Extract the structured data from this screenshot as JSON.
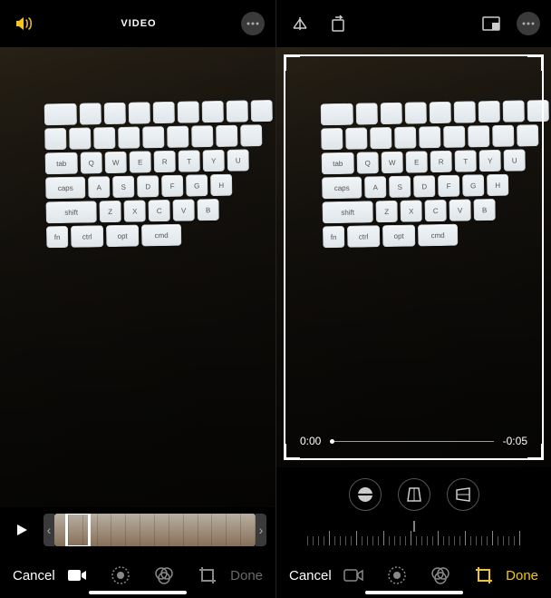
{
  "left": {
    "topbar": {
      "title": "VIDEO"
    },
    "toolbar": {
      "cancel": "Cancel",
      "done": "Done"
    }
  },
  "right": {
    "timecodes": {
      "current": "0:00",
      "remaining": "-0:05"
    },
    "toolbar": {
      "cancel": "Cancel",
      "done": "Done"
    }
  },
  "colors": {
    "accent": "#f5c518",
    "muted": "#6a6a6a"
  },
  "icons": {
    "sound": "sound-icon",
    "more": "more-icon",
    "perspective": "perspective-icon",
    "aspect": "aspect-ratio-icon",
    "play": "play-icon",
    "video": "video-icon",
    "adjust": "adjust-icon",
    "filters": "filters-icon",
    "crop": "crop-icon",
    "straighten": "straighten-icon",
    "flipH": "flip-horizontal-icon",
    "flipV": "flip-vertical-icon"
  }
}
